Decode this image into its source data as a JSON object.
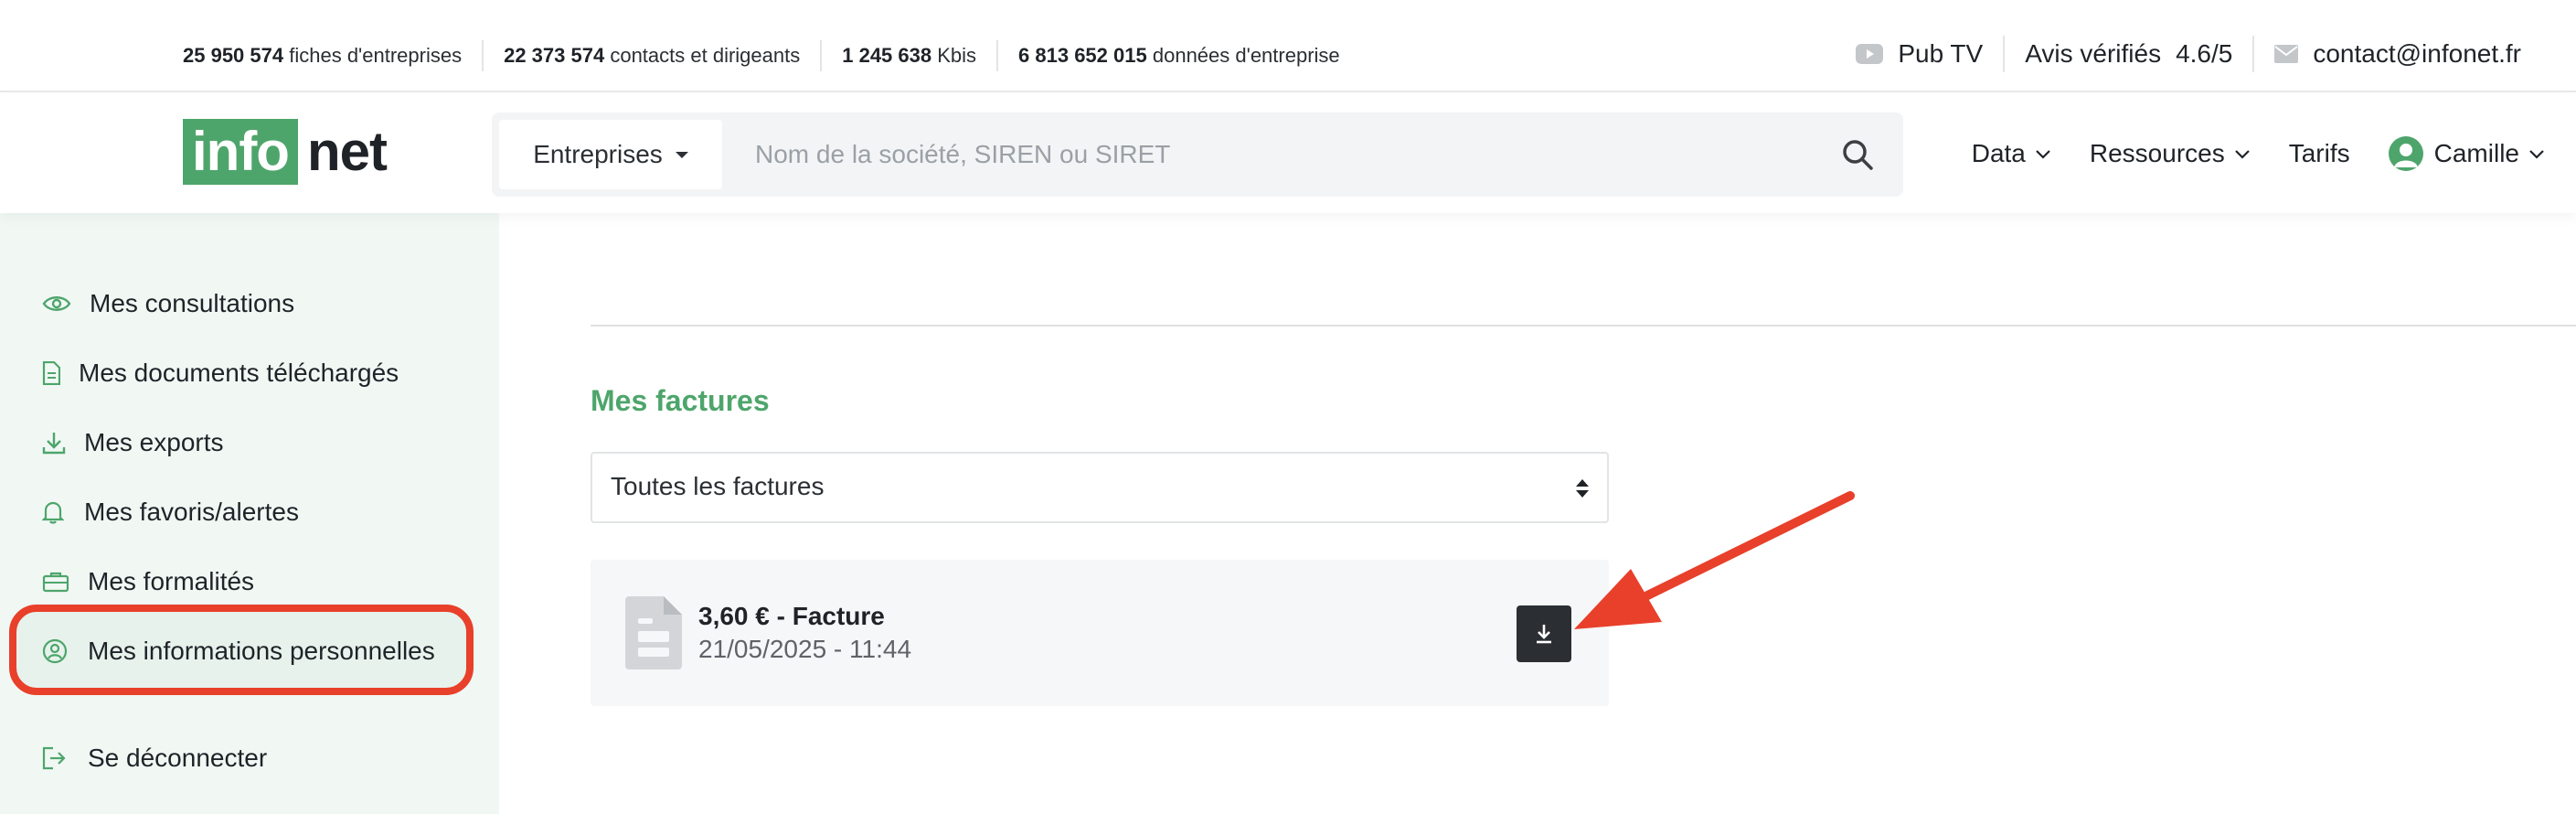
{
  "stats": [
    {
      "value": "25 950 574",
      "label": "fiches d'entreprises"
    },
    {
      "value": "22 373 574",
      "label": "contacts et dirigeants"
    },
    {
      "value": "1 245 638",
      "label": "Kbis"
    },
    {
      "value": "6 813 652 015",
      "label": "données d'entreprise"
    }
  ],
  "top_right": {
    "pub_tv": "Pub TV",
    "avis_label": "Avis vérifiés",
    "avis_rating": "4.6/5",
    "contact": "contact@infonet.fr"
  },
  "logo": {
    "part1": "info",
    "part2": "net"
  },
  "search": {
    "category": "Entreprises",
    "placeholder": "Nom de la société, SIREN ou SIRET"
  },
  "nav": {
    "data": "Data",
    "ressources": "Ressources",
    "tarifs": "Tarifs",
    "user": "Camille"
  },
  "sidebar": [
    {
      "label": "Mes consultations",
      "icon": "eye-icon"
    },
    {
      "label": "Mes documents téléchargés",
      "icon": "document-icon"
    },
    {
      "label": "Mes exports",
      "icon": "download-icon"
    },
    {
      "label": "Mes favoris/alertes",
      "icon": "bell-icon"
    },
    {
      "label": "Mes formalités",
      "icon": "briefcase-icon"
    },
    {
      "label": "Mes informations personnelles",
      "icon": "user-circle-icon"
    },
    {
      "label": "Se déconnecter",
      "icon": "logout-icon"
    }
  ],
  "main": {
    "section_title": "Mes factures",
    "filter_value": "Toutes les factures",
    "invoice": {
      "title": "3,60 € - Facture",
      "date": "21/05/2025 - 11:44"
    }
  },
  "colors": {
    "brand_green": "#4ea56b",
    "annotation_red": "#e8402a",
    "dark_button": "#2b2f33"
  }
}
